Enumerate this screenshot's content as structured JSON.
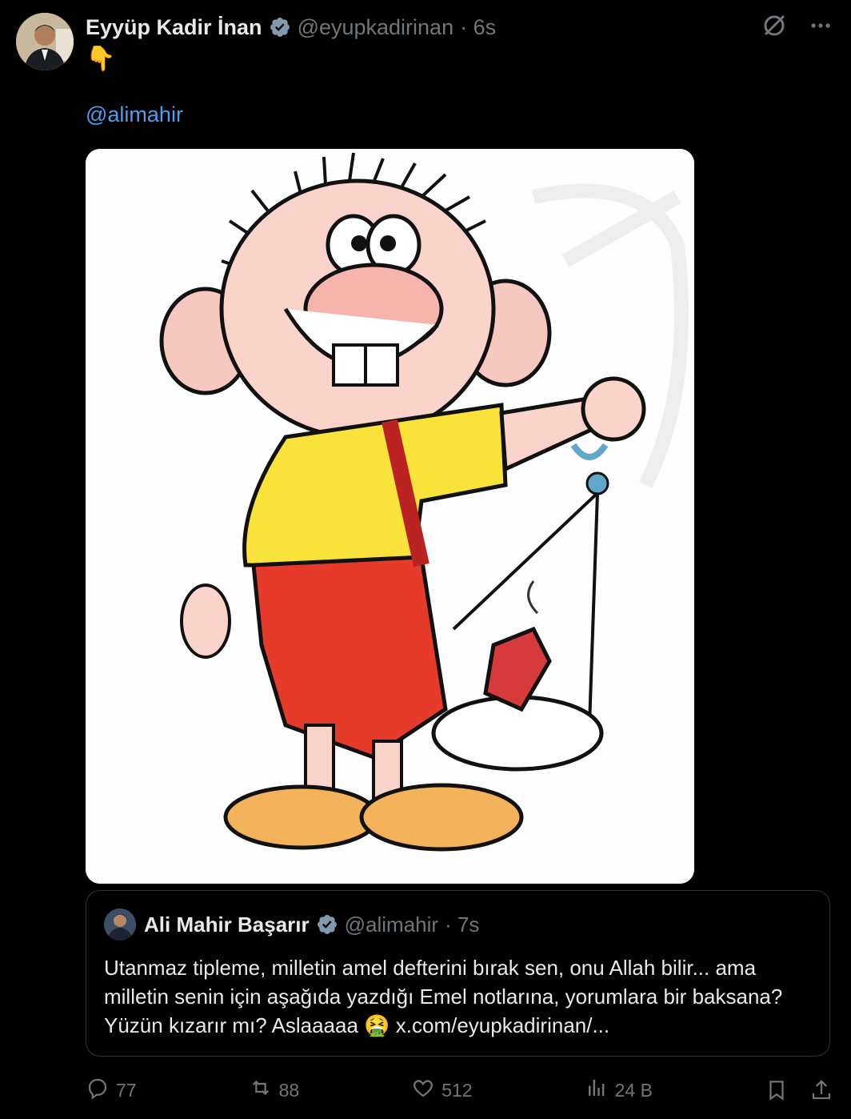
{
  "post": {
    "author_name": "Eyyüp Kadir İnan",
    "author_handle": "@eyupkadirinan",
    "time": "· 6s",
    "emoji": "👇",
    "mention": "@alimahir",
    "media_alt": "cartoon character illustration"
  },
  "quote": {
    "author_name": "Ali Mahir Başarır",
    "author_handle": "@alimahir",
    "time": "· 7s",
    "text": "Utanmaz tipleme,  milletin amel defterini bırak sen, onu Allah bilir... ama milletin senin için aşağıda yazdığı Emel notlarına, yorumlara bir baksana? Yüzün kızarır mı? Aslaaaaa ",
    "emoji": "🤮",
    "link": "x.com/eyupkadirinan/..."
  },
  "actions": {
    "replies": "77",
    "reposts": "88",
    "likes": "512",
    "views": "24 B"
  },
  "icons": {
    "verified": "verified-badge-icon",
    "grok": "grok-icon",
    "more": "more-icon",
    "reply": "reply-icon",
    "repost": "repost-icon",
    "like": "heart-icon",
    "views": "views-icon",
    "bookmark": "bookmark-icon",
    "share": "share-icon"
  },
  "colors": {
    "background": "#000000",
    "text": "#e7e9ea",
    "muted": "#71767b",
    "link": "#4d9ff0",
    "verified": "#829aab"
  }
}
